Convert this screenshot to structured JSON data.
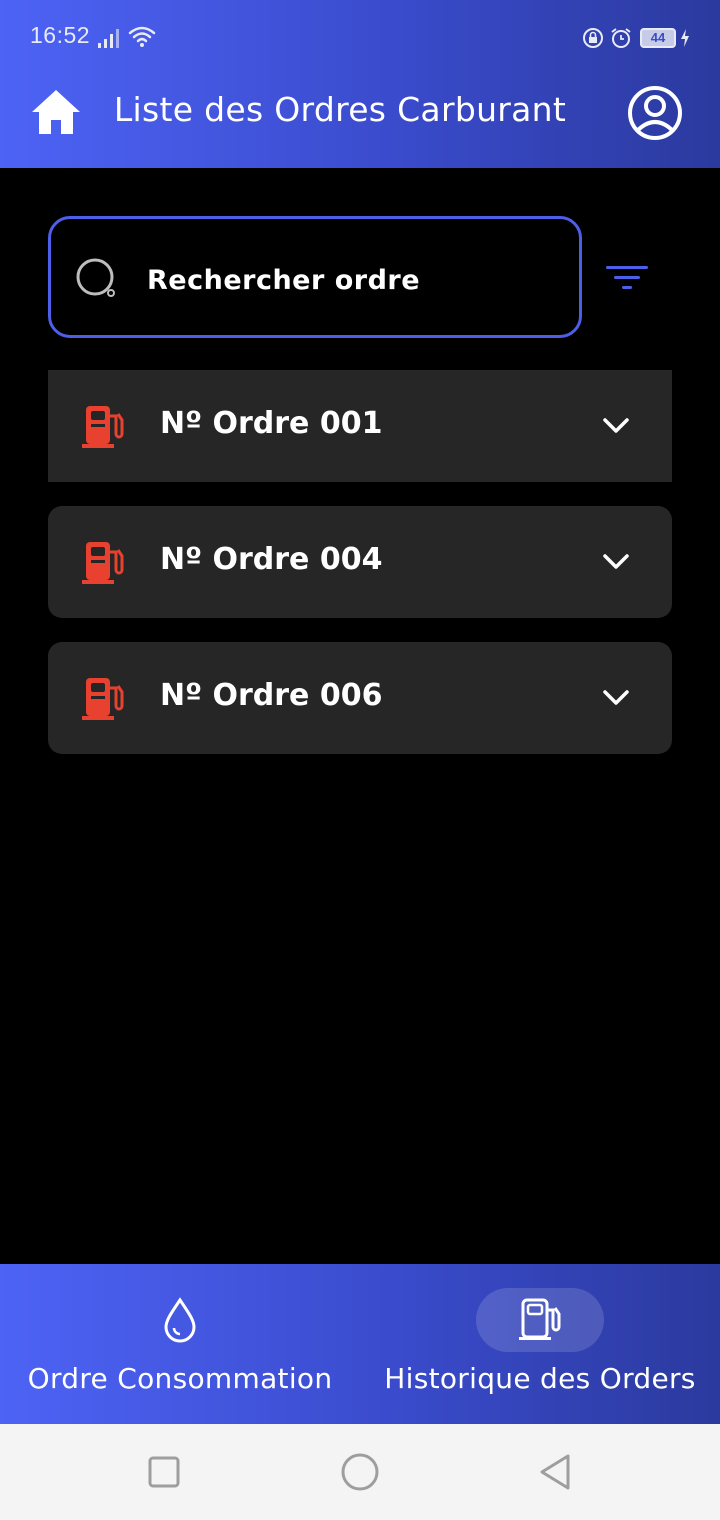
{
  "status_bar": {
    "time": "16:52",
    "battery": "44"
  },
  "header": {
    "title": "Liste des Ordres Carburant",
    "home_icon": "home-icon",
    "profile_icon": "account-circle-icon"
  },
  "search": {
    "placeholder": "Rechercher ordre",
    "value": "",
    "search_icon": "search-icon",
    "filter_icon": "filter-icon"
  },
  "orders": [
    {
      "label": "Nº Ordre 001",
      "icon": "fuel-pump-icon"
    },
    {
      "label": "Nº Ordre 004",
      "icon": "fuel-pump-icon"
    },
    {
      "label": "Nº Ordre 006",
      "icon": "fuel-pump-icon"
    }
  ],
  "bottom_nav": {
    "items": [
      {
        "label": "Ordre Consommation",
        "icon": "water-drop-icon",
        "selected": false
      },
      {
        "label": "Historique des Orders",
        "icon": "fuel-pump-icon",
        "selected": true
      }
    ]
  },
  "colors": {
    "header_gradient_start": "#4d63f5",
    "header_gradient_end": "#2b3a9e",
    "accent": "#4d5fe8",
    "card_background": "#262626",
    "pump_icon": "#e8412f",
    "background": "#000000"
  }
}
